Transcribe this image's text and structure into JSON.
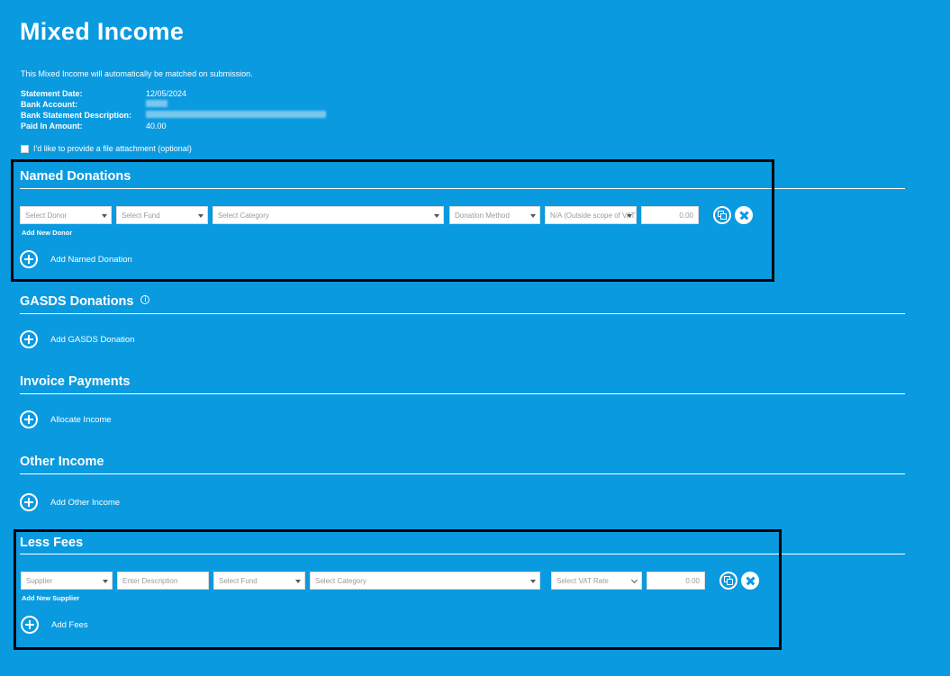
{
  "page": {
    "title": "Mixed Income",
    "note": "This Mixed Income will automatically be matched on submission."
  },
  "meta": [
    {
      "label": "Statement Date:",
      "value": "12/05/2024"
    },
    {
      "label": "Bank Account:",
      "value": ""
    },
    {
      "label": "Bank Statement Description:",
      "value": ""
    },
    {
      "label": "Paid In Amount:",
      "value": "40.00"
    }
  ],
  "attachment": {
    "label": "I'd like to provide a file attachment (optional)"
  },
  "named_donations": {
    "title": "Named Donations",
    "donor_placeholder": "Select Donor",
    "fund_placeholder": "Select Fund",
    "category_placeholder": "Select Category",
    "method_placeholder": "Donation Method",
    "vat_value": "N/A (Outside scope of VAT)",
    "amount": "0.00",
    "add_new_donor": "Add New Donor",
    "add_label": "Add Named Donation"
  },
  "gasds": {
    "title": "GASDS Donations",
    "add_label": "Add GASDS Donation"
  },
  "invoice": {
    "title": "Invoice Payments",
    "add_label": "Allocate Income"
  },
  "other": {
    "title": "Other Income",
    "add_label": "Add Other Income"
  },
  "less_fees": {
    "title": "Less Fees",
    "supplier_placeholder": "Supplier",
    "description_placeholder": "Enter Description",
    "fund_placeholder": "Select Fund",
    "category_placeholder": "Select Category",
    "vat_placeholder": "Select VAT Rate",
    "amount": "0.00",
    "add_new_supplier": "Add New Supplier",
    "add_label": "Add Fees"
  },
  "colors": {
    "background": "#0a9ae0",
    "text": "#ffffff",
    "highlight": "#000000"
  }
}
